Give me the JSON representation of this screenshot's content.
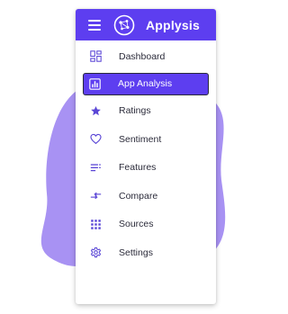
{
  "app": {
    "title": "Applysis"
  },
  "colors": {
    "primary": "#5d3ef0",
    "icon": "#5b47d6",
    "blob": "#a892f3"
  },
  "nav": {
    "items": [
      {
        "label": "Dashboard",
        "icon": "dashboard-icon",
        "active": false
      },
      {
        "label": "App Analysis",
        "icon": "analysis-icon",
        "active": true
      },
      {
        "label": "Ratings",
        "icon": "star-icon",
        "active": false
      },
      {
        "label": "Sentiment",
        "icon": "heart-icon",
        "active": false
      },
      {
        "label": "Features",
        "icon": "list-icon",
        "active": false
      },
      {
        "label": "Compare",
        "icon": "compare-arrows-icon",
        "active": false
      },
      {
        "label": "Sources",
        "icon": "grid-icon",
        "active": false
      },
      {
        "label": "Settings",
        "icon": "gear-icon",
        "active": false
      }
    ]
  }
}
